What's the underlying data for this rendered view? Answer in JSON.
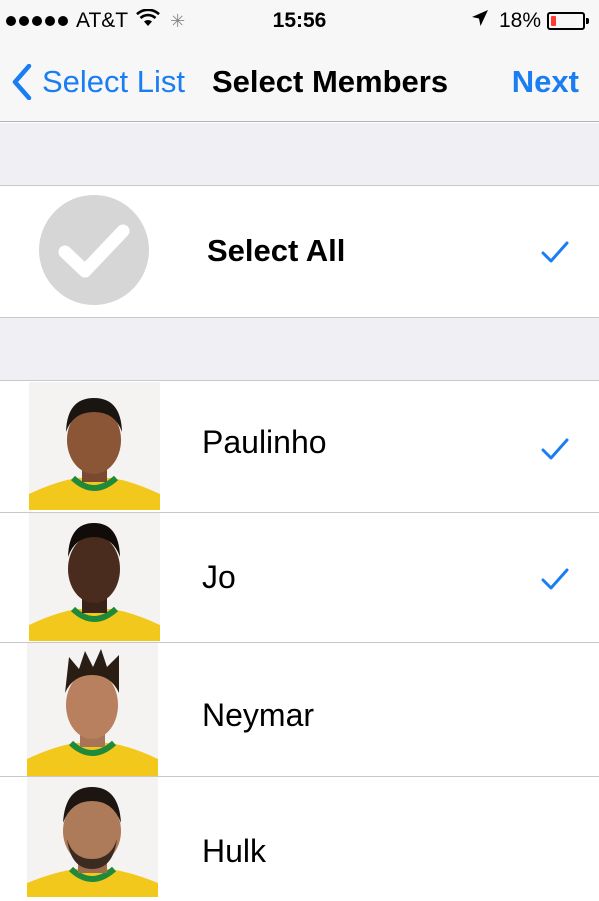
{
  "status_bar": {
    "carrier": "AT&T",
    "time": "15:56",
    "battery_percent": "18%",
    "battery_level": 0.18
  },
  "nav": {
    "back_label": "Select List",
    "title": "Select Members",
    "next_label": "Next"
  },
  "select_all": {
    "label": "Select All",
    "checked": true
  },
  "members": [
    {
      "name": "Paulinho",
      "checked": true
    },
    {
      "name": "Jo",
      "checked": true
    },
    {
      "name": "Neymar",
      "checked": false
    },
    {
      "name": "Hulk",
      "checked": false
    }
  ],
  "colors": {
    "accent": "#1a7ef2",
    "jersey_yellow": "#f2c81d",
    "jersey_green": "#1f8a3a"
  }
}
